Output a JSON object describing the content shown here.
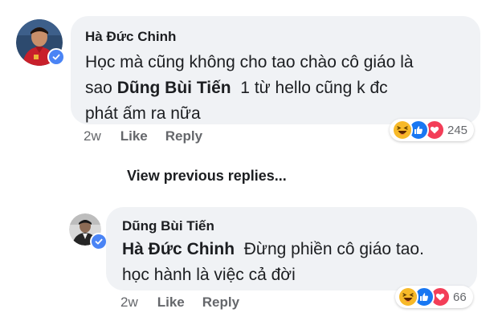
{
  "comment": {
    "author": "Hà Đức Chinh",
    "line1": "Học mà cũng không cho tao chào cô giáo là",
    "line2_prefix": "sao ",
    "line2_mention": "Dũng Bùi Tiến",
    "line2_suffix": "  1 từ hello cũng k đc",
    "line3": "phát ấm ra nữa",
    "time": "2w",
    "like_label": "Like",
    "reply_label": "Reply",
    "reaction_icons": [
      "haha-icon",
      "like-icon",
      "love-icon"
    ],
    "reaction_count": "245"
  },
  "view_previous_label": "View previous replies...",
  "reply": {
    "author": "Dũng Bùi Tiến",
    "line1_mention": "Hà Đức Chinh",
    "line1_suffix": "  Đừng phiền cô giáo tao.",
    "line2": "học hành là việc cả đời",
    "time": "2w",
    "like_label": "Like",
    "reply_label": "Reply",
    "reaction_icons": [
      "haha-icon",
      "like-icon",
      "love-icon"
    ],
    "reaction_count": "66"
  },
  "colors": {
    "bubble": "#f0f2f5",
    "text": "#1c1e21",
    "meta": "#65676b",
    "verified": "#4a84f5",
    "like": "#1877f2",
    "love": "#f33e58",
    "haha": "#f7b928"
  }
}
